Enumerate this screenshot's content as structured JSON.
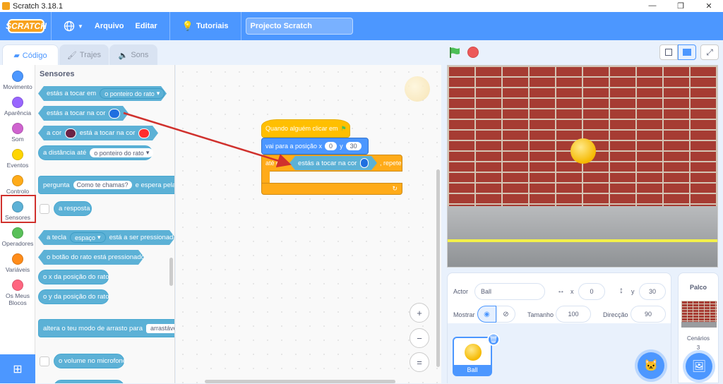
{
  "window": {
    "title": "Scratch 3.18.1",
    "buttons": [
      "—",
      "❐",
      "✕"
    ]
  },
  "menubar": {
    "logo": "SCRATCH",
    "language_icon": "globe-icon",
    "file": "Arquivo",
    "edit": "Editar",
    "tutorials": "Tutoriais",
    "project_title": "Projecto Scratch"
  },
  "tabs": {
    "code": "Código",
    "costumes": "Trajes",
    "sounds": "Sons"
  },
  "categories": [
    {
      "label": "Movimento",
      "color": "#4c97ff"
    },
    {
      "label": "Aparência",
      "color": "#9966ff"
    },
    {
      "label": "Som",
      "color": "#cf63cf"
    },
    {
      "label": "Eventos",
      "color": "#ffd500"
    },
    {
      "label": "Controlo",
      "color": "#ffab19"
    },
    {
      "label": "Sensores",
      "color": "#5cb1d6"
    },
    {
      "label": "Operadores",
      "color": "#59c059"
    },
    {
      "label": "Variáveis",
      "color": "#ff8c1a"
    },
    {
      "label": "Os Meus Blocos",
      "color": "#ff6680"
    }
  ],
  "palette": {
    "title": "Sensores",
    "touching_prefix": "estás a tocar em",
    "touching_dd": "o ponteiro do rato",
    "touching_color": "estás a tocar na cor",
    "color_a": "a cor",
    "color_touching": "está a tocar na cor",
    "distance_prefix": "a distância até",
    "distance_dd": "o ponteiro do rato",
    "ask_prefix": "pergunta",
    "ask_input": "Como te chamas?",
    "ask_suffix": "e espera pela re",
    "answer": "a resposta",
    "key_prefix": "a tecla",
    "key_dd": "espaço",
    "key_suffix": "está a ser pressionada",
    "mouse_down": "o botão do rato está pressionado",
    "mouse_x": "o x da posição do rato",
    "mouse_y": "o y da posição do rato",
    "drag_prefix": "altera o teu modo de arrasto para",
    "drag_dd": "arrastável",
    "loudness": "o volume no microfone"
  },
  "script": {
    "hat": "Quando alguém clicar em",
    "goto_prefix": "vai para a posição x",
    "goto_x": "0",
    "goto_y_label": "y",
    "goto_y": "30",
    "repeat_prefix": "até que",
    "repeat_cond": "estás a tocar na cor",
    "repeat_suffix": ", repete",
    "loop_icon": "↻"
  },
  "zoom": {
    "in": "+",
    "out": "−",
    "reset": "="
  },
  "sprite_info": {
    "actor_label": "Actor",
    "actor_name": "Ball",
    "x_label": "x",
    "x": "0",
    "y_label": "y",
    "y": "30",
    "show_label": "Mostrar",
    "size_label": "Tamanho",
    "size": "100",
    "direction_label": "Direcção",
    "direction": "90"
  },
  "sprites": [
    {
      "name": "Ball"
    }
  ],
  "stage_pane": {
    "title": "Palco",
    "backdrops_label": "Cenários",
    "backdrops_count": "3"
  },
  "colors": {
    "sensing_swatch": "#1f6fe0",
    "color_a": "#6b2346",
    "color_b": "#ff2d2d",
    "highlight_red": "#d0312d"
  }
}
